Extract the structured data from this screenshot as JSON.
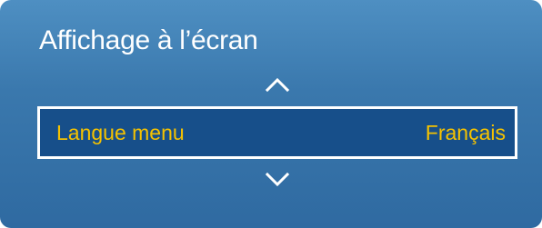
{
  "osd": {
    "title": "Affichage à l’écran",
    "scroll_up_icon": "chevron-up",
    "scroll_down_icon": "chevron-down",
    "selected_item": {
      "label": "Langue menu",
      "value": "Français"
    },
    "colors": {
      "panel": "#3a78ad",
      "selected_row": "#174f8a",
      "selected_text": "#f5c200",
      "title_text": "#ffffff"
    }
  }
}
